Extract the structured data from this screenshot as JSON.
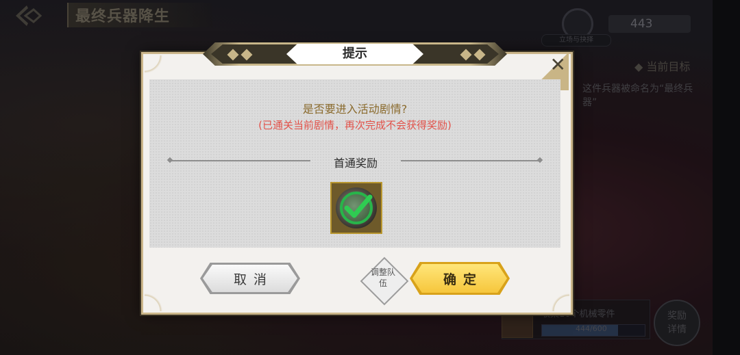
{
  "game": {
    "stage_title": "最终兵器降生",
    "resource_value": "443",
    "resource_caption": "立场与抉择"
  },
  "side_panel": {
    "goal_heading": "当前目标",
    "goal_text": "这件兵器被命名为“最终兵器”",
    "collect_text": "收集10个机械零件",
    "progress_value": "444/600",
    "progress_fraction": 0.74,
    "reward_detail_label": "奖励详情"
  },
  "dialog": {
    "title": "提示",
    "question": "是否要进入活动剧情?",
    "note": "(已通关当前剧情，再次完成不会获得奖励)",
    "section_label": "首通奖励",
    "reward_claimed": true,
    "cancel_label": "取消",
    "adjust_team_label": "调整队伍",
    "confirm_label": "确定"
  },
  "colors": {
    "note_red": "#e2524a",
    "question_gold": "#8a6a2c",
    "confirm_yellow": "#f6c63c",
    "check_green": "#28b44a"
  }
}
